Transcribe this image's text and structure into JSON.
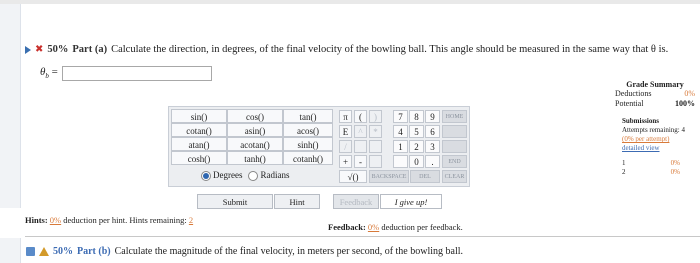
{
  "part_a": {
    "percent": "50%",
    "label": "Part (a)",
    "question": "Calculate the direction, in degrees, of the final velocity of the bowling ball. This angle should be measured in the same way that θ is.",
    "answer_symbol": "θ",
    "answer_subscript": "b",
    "answer_equals": "=",
    "answer_value": ""
  },
  "grade_summary": {
    "title": "Grade Summary",
    "deductions_label": "Deductions",
    "deductions_value": "0%",
    "potential_label": "Potential",
    "potential_value": "100%"
  },
  "submissions": {
    "title": "Submissions",
    "attempts_line": "Attempts remaining: 4",
    "per_attempt": "(0% per attempt)",
    "detailed_view": "detailed view",
    "rows": [
      {
        "n": "1",
        "pct": "0%"
      },
      {
        "n": "2",
        "pct": "0%"
      }
    ]
  },
  "calculator": {
    "functions": [
      "sin()",
      "cos()",
      "tan()",
      "cotan()",
      "asin()",
      "acos()",
      "atan()",
      "acotan()",
      "sinh()",
      "cosh()",
      "tanh()",
      "cotanh()"
    ],
    "mode_degrees": "Degrees",
    "mode_radians": "Radians",
    "selected_mode": "Degrees",
    "symbols": {
      "pi": "π",
      "lparen": "(",
      "e": "E",
      "caret": "^",
      "plus": "+",
      "minus": "-",
      "sqrt": "√()",
      "star": "*",
      "slash": "/",
      "rparen": ")"
    },
    "digits": [
      "7",
      "8",
      "9",
      "4",
      "5",
      "6",
      "1",
      "2",
      "3",
      "0",
      "."
    ],
    "home": "HOME",
    "end": "END",
    "backspace": "BACKSPACE",
    "del": "DEL",
    "clear": "CLEAR"
  },
  "buttons": {
    "submit": "Submit",
    "hint": "Hint",
    "feedback": "Feedback",
    "give_up": "I give up!"
  },
  "hints": {
    "label": "Hints:",
    "deduction": "0%",
    "text": "deduction per hint. Hints remaining:",
    "remaining": "2"
  },
  "feedback": {
    "label": "Feedback:",
    "deduction": "0%",
    "text": "deduction per feedback."
  },
  "part_b": {
    "percent": "50%",
    "label": "Part (b)",
    "question": "Calculate the magnitude of the final velocity, in meters per second, of the bowling ball."
  }
}
